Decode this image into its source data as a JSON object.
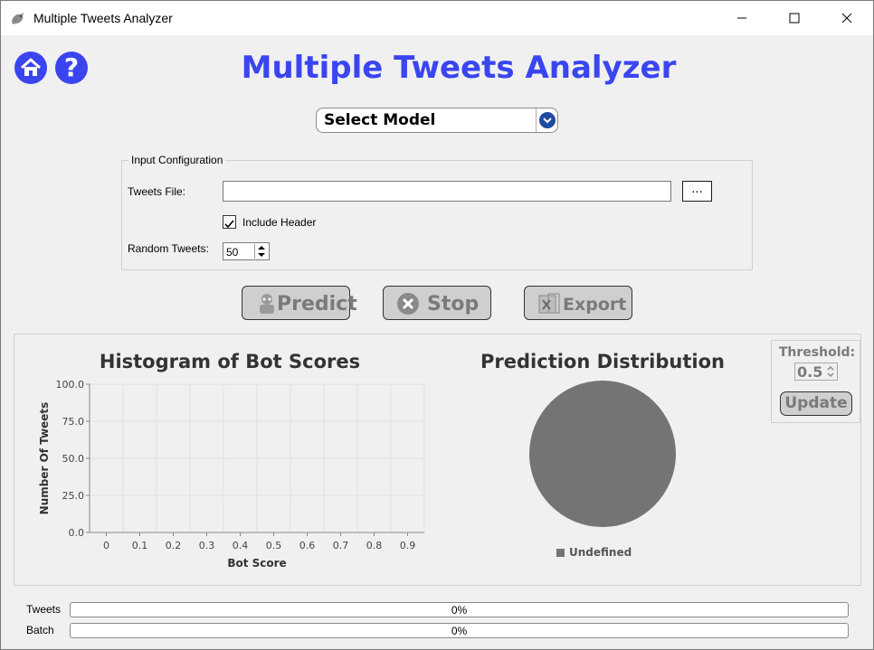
{
  "window": {
    "title": "Multiple Tweets Analyzer"
  },
  "header": {
    "title": "Multiple Tweets Analyzer",
    "help_glyph": "?"
  },
  "model_select": {
    "value": "Select Model"
  },
  "input_config": {
    "title": "Input Configuration",
    "tweets_file_label": "Tweets File:",
    "tweets_file_value": "",
    "browse_label": "...",
    "include_header_label": "Include Header",
    "include_header_checked": true,
    "random_tweets_label": "Random Tweets:",
    "random_tweets_value": "50"
  },
  "actions": {
    "predict": "Predict",
    "stop": "Stop",
    "export": "Export"
  },
  "threshold": {
    "label": "Threshold:",
    "value": "0.5",
    "update": "Update"
  },
  "chart_data": [
    {
      "type": "bar",
      "title": "Histogram of Bot Scores",
      "xlabel": "Bot Score",
      "ylabel": "Number Of Tweets",
      "categories": [
        "0",
        "0.1",
        "0.2",
        "0.3",
        "0.4",
        "0.5",
        "0.6",
        "0.7",
        "0.8",
        "0.9"
      ],
      "values": [
        0,
        0,
        0,
        0,
        0,
        0,
        0,
        0,
        0,
        0
      ],
      "ylim": [
        0,
        100
      ],
      "yticks": [
        "0.0",
        "25.0",
        "50.0",
        "75.0",
        "100.0"
      ],
      "grid": true
    },
    {
      "type": "pie",
      "title": "Prediction Distribution",
      "labels": [
        "Undefined"
      ],
      "values": [
        1
      ],
      "colors": [
        "#737574"
      ],
      "legend": "bottom"
    }
  ],
  "progress": {
    "tweets": {
      "label": "Tweets",
      "percent": 0,
      "text": "0%"
    },
    "batch": {
      "label": "Batch",
      "percent": 0,
      "text": "0%"
    }
  },
  "colors": {
    "accent": "#3a45f0",
    "disabled_text": "#7a7a7a",
    "pie_fill": "#737574"
  }
}
